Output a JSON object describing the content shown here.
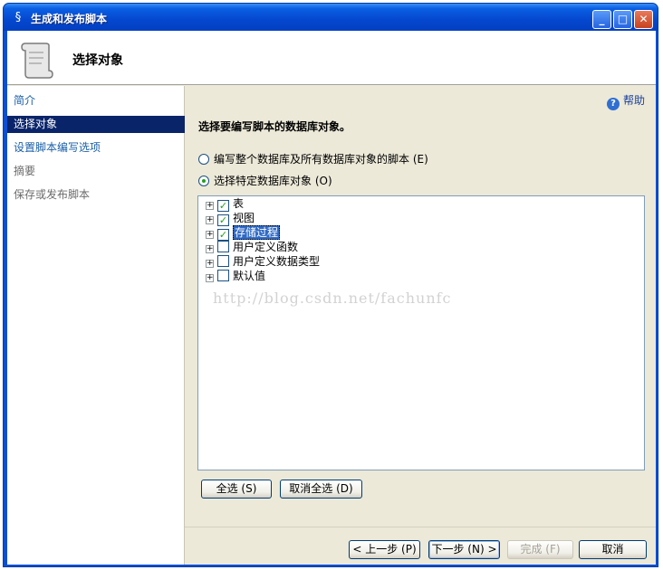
{
  "window": {
    "title": "生成和发布脚本"
  },
  "header": {
    "title": "选择对象"
  },
  "sidebar": {
    "items": [
      {
        "label": "简介"
      },
      {
        "label": "选择对象"
      },
      {
        "label": "设置脚本编写选项"
      },
      {
        "label": "摘要"
      },
      {
        "label": "保存或发布脚本"
      }
    ],
    "active_index": 1
  },
  "help": {
    "label": "帮助"
  },
  "main": {
    "prompt": "选择要编写脚本的数据库对象。",
    "radio_all": "编写整个数据库及所有数据库对象的脚本 (E)",
    "radio_specific": "选择特定数据库对象 (O)",
    "selected_radio": "specific",
    "tree": [
      {
        "label": "表",
        "checked": true
      },
      {
        "label": "视图",
        "checked": true
      },
      {
        "label": "存储过程",
        "checked": true,
        "selected": true
      },
      {
        "label": "用户定义函数",
        "checked": false
      },
      {
        "label": "用户定义数据类型",
        "checked": false
      },
      {
        "label": "默认值",
        "checked": false
      }
    ],
    "watermark": "http://blog.csdn.net/fachunfc",
    "select_all": "全选 (S)",
    "deselect_all": "取消全选 (D)"
  },
  "footer": {
    "prev": "< 上一步 (P)",
    "next": "下一步 (N) >",
    "finish": "完成 (F)",
    "cancel": "取消"
  }
}
